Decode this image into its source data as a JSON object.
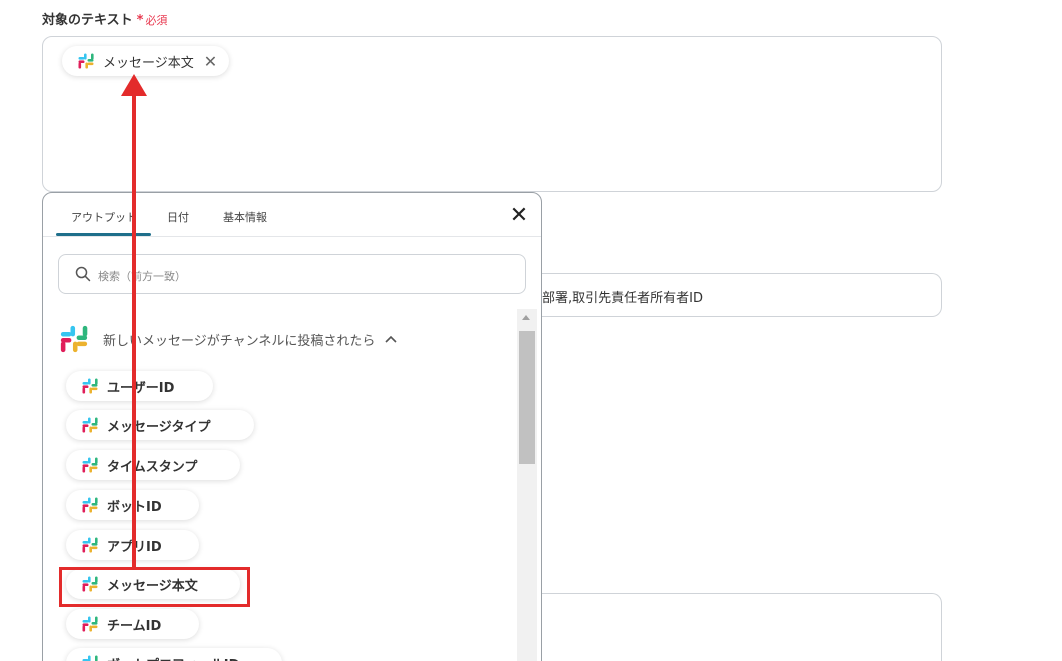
{
  "field": {
    "label": "対象のテキスト",
    "asterisk": "*",
    "required": "必須"
  },
  "selected_chip": {
    "label": "メッセージ本文",
    "remove_icon": "close-icon"
  },
  "background_field_text": "部署,取引先責任者所有者ID",
  "popup": {
    "tabs": [
      "アウトプット",
      "日付",
      "基本情報"
    ],
    "active_tab": "アウトプット",
    "close_icon": "close-icon",
    "search_placeholder": "検索（前方一致）",
    "section_title": "新しいメッセージがチャンネルに投稿されたら",
    "items": [
      "ユーザーID",
      "メッセージタイプ",
      "タイムスタンプ",
      "ボットID",
      "アプリID",
      "メッセージ本文",
      "チームID",
      "ボットプロフィールID"
    ],
    "highlighted_item": "メッセージ本文"
  },
  "colors": {
    "required": "#e8384f",
    "tab_underline": "#1f6f8b",
    "annotation": "#e32b2b"
  }
}
